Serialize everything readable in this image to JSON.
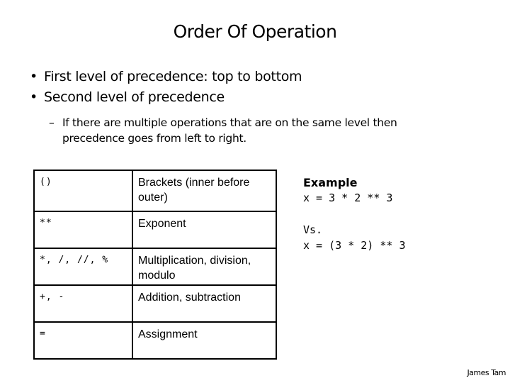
{
  "slide": {
    "title": "Order Of Operation",
    "bullets": [
      "First level of precedence: top to bottom",
      "Second level of precedence"
    ],
    "bullet_glyph": "•",
    "sub_bullet_glyph": "–",
    "sub_bullet": "If there are multiple operations that are on the same level then precedence goes from left to right."
  },
  "precedence_table": {
    "rows": [
      {
        "operator": "()",
        "description": "Brackets (inner before outer)"
      },
      {
        "operator": "**",
        "description": "Exponent"
      },
      {
        "operator": "*, /, //, %",
        "description": "Multiplication, division, modulo"
      },
      {
        "operator": "+, -",
        "description": "Addition, subtraction"
      },
      {
        "operator": "=",
        "description": "Assignment"
      }
    ]
  },
  "example": {
    "heading": "Example",
    "line1": "x = 3 * 2 ** 3",
    "versus": "Vs.",
    "line2": "x = (3 * 2) ** 3"
  },
  "footer": {
    "author": "James Tam"
  }
}
